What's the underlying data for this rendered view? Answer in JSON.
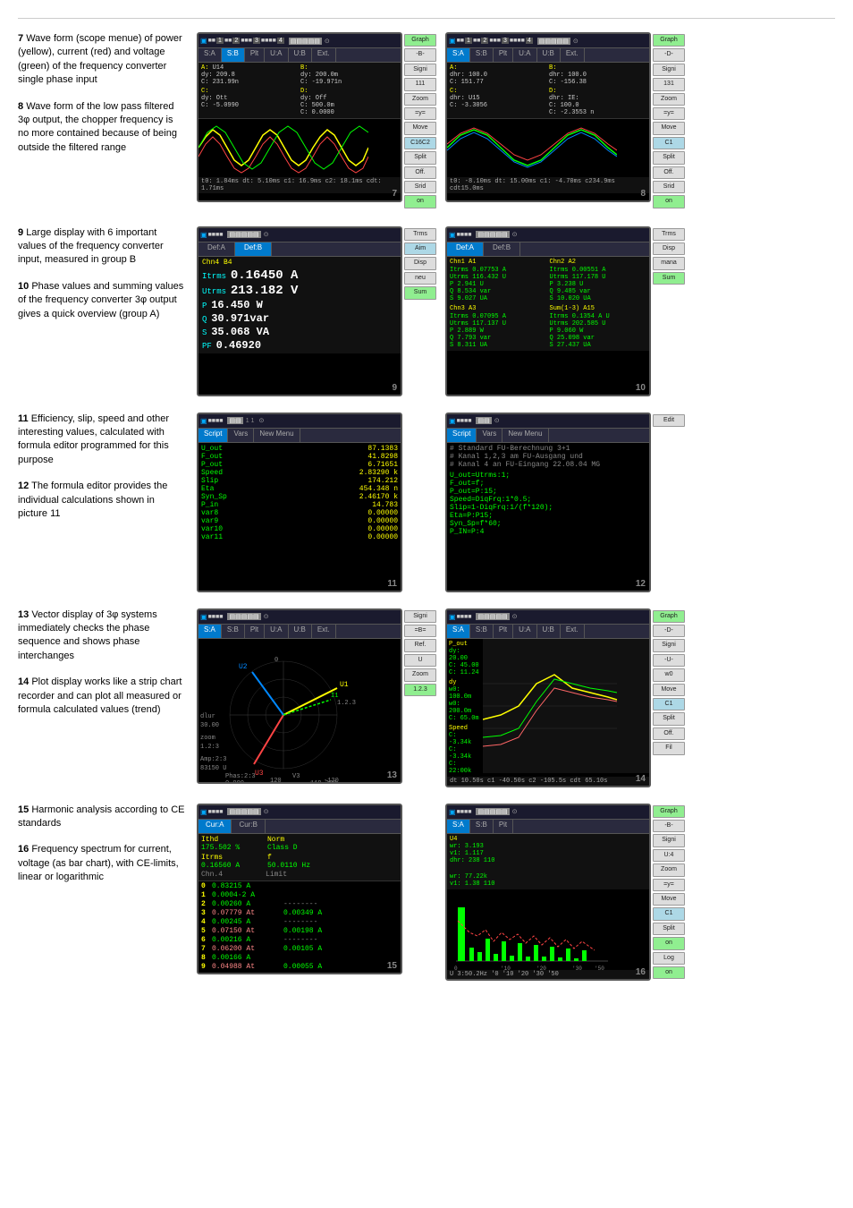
{
  "divider": true,
  "sections": [
    {
      "id": "row1",
      "items": [
        {
          "num": "7",
          "text": "Wave form (scope menue) of power (yellow), current (red) and voltage (green) of the frequency converter single phase input"
        },
        {
          "num": "8",
          "text": "Wave form of the low pass filtered 3φ output, the chopper frequency is no more contained because of being outside the filtered range"
        }
      ],
      "screens": [
        {
          "id": "screen7",
          "number": "7",
          "type": "waveform",
          "tabs": [
            "S:A",
            "S:B",
            "Plt",
            "U:A",
            "U:B",
            "Ext."
          ],
          "active_tab": "S:B",
          "right_btns": [
            "Graph",
            "-B-",
            "Signi",
            "111",
            "Zoom",
            "=y=",
            "Move",
            "C16C2",
            "Split",
            "Off.",
            "Srid",
            "on"
          ]
        },
        {
          "id": "screen8",
          "number": "8",
          "type": "waveform",
          "tabs": [
            "S:A",
            "S:B",
            "Plt",
            "U:A",
            "U:B",
            "Ext."
          ],
          "active_tab": "S:A",
          "right_btns": [
            "Graph",
            "-D-",
            "Signi",
            "131",
            "Zoom",
            "=y=",
            "Move",
            "C1",
            "Split",
            "Off.",
            "Srid",
            "on"
          ]
        }
      ]
    },
    {
      "id": "row2",
      "items": [
        {
          "num": "9",
          "text": "Large display with 6 important values of the frequency converter input, measured in group B"
        },
        {
          "num": "10",
          "text": "Phase values and summing values of the frequency converter 3φ output gives a quick overview (group A)"
        }
      ],
      "screens": [
        {
          "id": "screen9",
          "number": "9",
          "type": "large_meas",
          "tabs": [
            "Def:A",
            "Def:B"
          ],
          "active_tab": "Def:A",
          "label": "Chn4 B4",
          "values": [
            {
              "name": "Itrms",
              "val": "0.16450 A",
              "large": true
            },
            {
              "name": "Utrms",
              "val": "213.182 V",
              "large": true
            },
            {
              "name": "P",
              "val": "16.450 W",
              "medium": true
            },
            {
              "name": "Q",
              "val": "30.971var",
              "medium": true
            },
            {
              "name": "S",
              "val": "35.068 VA",
              "medium": true
            },
            {
              "name": "PF",
              "val": "0.46920",
              "medium": true
            }
          ],
          "right_btns": [
            "Trms",
            "Aim",
            "Disp",
            "neu",
            "Sum"
          ]
        },
        {
          "id": "screen10",
          "number": "10",
          "type": "multi_meas",
          "tabs": [
            "Def:A",
            "Def:B"
          ],
          "active_tab": "Def:A",
          "groups": [
            {
              "label": "Chn1 A1",
              "rows": [
                [
                  "Itrms",
                  "0.07753 A"
                ],
                [
                  "Utrms",
                  "116.432 U"
                ],
                [
                  "P",
                  "2.941 U"
                ],
                [
                  "Q",
                  "8.534 var"
                ],
                [
                  "S",
                  "9.027 UA"
                ]
              ]
            },
            {
              "label": "Chn2 A2",
              "rows": [
                [
                  "Itrms",
                  "0.00551 A"
                ],
                [
                  "Utrms",
                  "117.178 U"
                ],
                [
                  "P",
                  "3.238 U"
                ],
                [
                  "Q",
                  "9.485 var"
                ],
                [
                  "S",
                  "10.020 UA"
                ]
              ]
            },
            {
              "label": "Chn3 A3",
              "rows": [
                [
                  "Itrms",
                  "0.07095 A"
                ],
                [
                  "Utrms",
                  "117.137 U"
                ],
                [
                  "P",
                  "2.889 W"
                ],
                [
                  "Q",
                  "7.793 var"
                ],
                [
                  "S",
                  "8.311 UA"
                ]
              ]
            },
            {
              "label": "Sum(1-3) A15",
              "rows": [
                [
                  "Itrms",
                  "0.1354 A U"
                ],
                [
                  "Utrms",
                  "202.585 U"
                ],
                [
                  "P",
                  "9.060 W"
                ],
                [
                  "Q",
                  "25.098 var"
                ],
                [
                  "S",
                  "27.437 UA"
                ]
              ]
            }
          ],
          "right_btns": [
            "Trms",
            "Disp",
            "mana",
            "Sum"
          ]
        }
      ]
    },
    {
      "id": "row3",
      "items": [
        {
          "num": "11",
          "text": "Efficiency, slip, speed and other interesting values, calculated with formula editor programmed for this purpose"
        },
        {
          "num": "12",
          "text": "The formula editor provides the individual calculations shown in picture 11"
        }
      ],
      "screens": [
        {
          "id": "screen11",
          "number": "11",
          "type": "script_vals",
          "tabs": [
            "Script",
            "Vars",
            "New Menu"
          ],
          "active_tab": "Script",
          "rows": [
            [
              "U_out",
              "87.1383"
            ],
            [
              "F_out",
              "41.8298"
            ],
            [
              "P_out",
              "6.71651"
            ],
            [
              "Speed",
              "2.83290 k"
            ],
            [
              "Slip",
              "174.212"
            ],
            [
              "Eta",
              "454.348 n"
            ],
            [
              "Syn_Sp",
              "2.46170 k"
            ],
            [
              "P_in",
              "14.783"
            ],
            [
              "var8",
              "0.00000"
            ],
            [
              "var9",
              "0.00000"
            ],
            [
              "var10",
              "0.00000"
            ],
            [
              "var11",
              "0.00000"
            ]
          ]
        },
        {
          "id": "screen12",
          "number": "12",
          "type": "script_code",
          "tabs": [
            "Script",
            "Vars",
            "New Menu"
          ],
          "active_tab": "Script",
          "comment_lines": [
            "# Standard FU-Berechnung 3+1",
            "# Kanal 1,2,3 am FU-Ausgang und",
            "# Kanal 4 an FU-Eingang 22.08.04 MG"
          ],
          "code_lines": [
            "U_out=Utrms:1;",
            "F_out=f;",
            "P_out=P:15;",
            "Speed=DiqFrq:1*0.5;",
            "Slip=1-DiqFrq:1/(f*120);",
            "Eta=P:P15;",
            "Syn_Sp=f*60;",
            "P_IN=P:4"
          ],
          "right_btns": [
            "Edit"
          ]
        }
      ]
    },
    {
      "id": "row4",
      "items": [
        {
          "num": "13",
          "text": "Vector display of 3φ systems immediately checks the phase sequence and shows phase interchanges"
        },
        {
          "num": "14",
          "text": "Plot display works like a strip chart recorder and can plot all measured or formula calculated values (trend)"
        }
      ],
      "screens": [
        {
          "id": "screen13",
          "number": "13",
          "type": "vector",
          "tabs": [
            "S:A",
            "S:B",
            "Plt",
            "U:A",
            "U:B",
            "Ext."
          ],
          "active_tab": "S:A",
          "right_btns": [
            "Signi",
            "=B=",
            "Ref.",
            "U",
            "Zoom",
            "1.2.3"
          ]
        },
        {
          "id": "screen14",
          "number": "14",
          "type": "plot",
          "tabs": [
            "S:A",
            "S:B",
            "Plt",
            "U:A",
            "U:B",
            "Ext."
          ],
          "active_tab": "S:A",
          "right_btns": [
            "Graph",
            "-D-",
            "Signi",
            "-U-",
            "w0",
            "Move",
            "C1",
            "Split",
            "Off.",
            "Fil"
          ]
        }
      ]
    },
    {
      "id": "row5",
      "items": [
        {
          "num": "15",
          "text": "Harmonic analysis according to CE standards"
        },
        {
          "num": "16",
          "text": "Frequency spectrum for current, voltage (as bar chart), with CE-limits, linear or logarithmic"
        }
      ],
      "screens": [
        {
          "id": "screen15",
          "number": "15",
          "type": "harmonic",
          "tabs": [
            "Cur:A",
            "Cur:B"
          ],
          "active_tab": "Cur:A",
          "header": {
            "ithd": "175.502 %",
            "norm": "Class D",
            "itrms": "0.16560 A",
            "f": "50.0110 Hz",
            "chn": "Chn.4",
            "limit": "Limit"
          },
          "rows": [
            [
              "0",
              "0.83215 A",
              ""
            ],
            [
              "1",
              "0.0004·2 A",
              ""
            ],
            [
              "2",
              "0.00260 A",
              "--------"
            ],
            [
              "3",
              "0.07779 At",
              "0.00349 A"
            ],
            [
              "4",
              "0.00245 A",
              "--------"
            ],
            [
              "5",
              "0.07150 At",
              "0.00198 A"
            ],
            [
              "6",
              "0.00216 A",
              "--------"
            ],
            [
              "7",
              "0.06200 At",
              "0.00105 A"
            ],
            [
              "8",
              "0.00166 A",
              ""
            ],
            [
              "9",
              "0.04988 At",
              "0.00055 A"
            ]
          ]
        },
        {
          "id": "screen16",
          "number": "16",
          "type": "spectrum",
          "tabs": [
            "S:A",
            "S:B",
            "Pit"
          ],
          "active_tab": "S:A",
          "right_btns": [
            "Graph",
            "-B-",
            "Signi",
            "U:4",
            "Zoom",
            "=y=",
            "Move",
            "C1",
            "Split",
            "on",
            "Log",
            "on"
          ]
        }
      ]
    }
  ]
}
